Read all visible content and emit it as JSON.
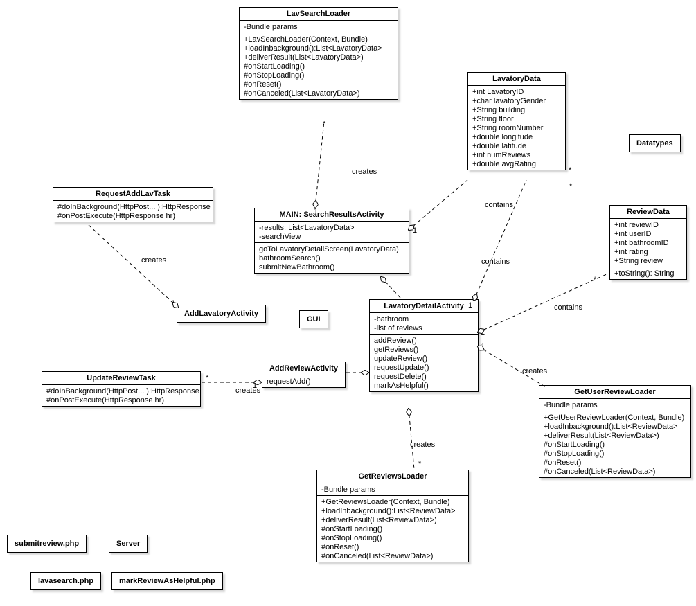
{
  "classes": {
    "lavSearchLoader": {
      "name": "LavSearchLoader",
      "attrs": [
        "-Bundle params"
      ],
      "ops": [
        "+LavSearchLoader(Context, Bundle)",
        "+loadInbackground():List<LavatoryData>",
        "+deliverResult(List<LavatoryData>)",
        "#onStartLoading()",
        "#onStopLoading()",
        "#onReset()",
        "#onCanceled(List<LavatoryData>)"
      ]
    },
    "lavatoryData": {
      "name": "LavatoryData",
      "attrs": [
        "+int LavatoryID",
        "+char lavatoryGender",
        "+String building",
        "+String floor",
        "+String roomNumber",
        "+double longitude",
        "+double latitude",
        "+int numReviews",
        "+double avgRating"
      ]
    },
    "datatypes": {
      "name": "Datatypes"
    },
    "requestAddLavTask": {
      "name": "RequestAddLavTask",
      "ops": [
        "#doInBackground(HttpPost... ):HttpResponse",
        "#onPostExecute(HttpResponse hr)"
      ]
    },
    "searchResultsActivity": {
      "name": "MAIN: SearchResultsActivity",
      "attrs": [
        "-results: List<LavatoryData>",
        "-searchView"
      ],
      "ops": [
        "goToLavatoryDetailScreen(LavatoryData)",
        "bathroomSearch()",
        "submitNewBathroom()"
      ]
    },
    "reviewData": {
      "name": "ReviewData",
      "attrs": [
        "+int reviewID",
        "+int userID",
        "+int bathroomID",
        "+int rating",
        "+String review"
      ],
      "ops": [
        "+toString(): String"
      ]
    },
    "addLavatoryActivity": {
      "name": "AddLavatoryActivity"
    },
    "gui": {
      "name": "GUI"
    },
    "lavatoryDetailActivity": {
      "name": "LavatoryDetailActivity",
      "attrs": [
        "-bathroom",
        "-list of reviews"
      ],
      "ops": [
        "addReview()",
        "getReviews()",
        "updateReview()",
        "requestUpdate()",
        "requestDelete()",
        "markAsHelpful()"
      ]
    },
    "addReviewActivity": {
      "name": "AddReviewActivity",
      "ops": [
        "requestAdd()"
      ]
    },
    "updateReviewTask": {
      "name": "UpdateReviewTask",
      "ops": [
        "#doInBackground(HttpPost... ):HttpResponse",
        "#onPostExecute(HttpResponse hr)"
      ]
    },
    "getUserReviewLoader": {
      "name": "GetUserReviewLoader",
      "attrs": [
        "-Bundle params"
      ],
      "ops": [
        "+GetUserReviewLoader(Context, Bundle)",
        "+loadInbackground():List<ReviewData>",
        "+deliverResult(List<ReviewData>)",
        "#onStartLoading()",
        "#onStopLoading()",
        "#onReset()",
        "#onCanceled(List<ReviewData>)"
      ]
    },
    "getReviewsLoader": {
      "name": "GetReviewsLoader",
      "attrs": [
        "-Bundle params"
      ],
      "ops": [
        "+GetReviewsLoader(Context, Bundle)",
        "+loadInbackground():List<ReviewData>",
        "+deliverResult(List<ReviewData>)",
        "#onStartLoading()",
        "#onStopLoading()",
        "#onReset()",
        "#onCanceled(List<ReviewData>)"
      ]
    },
    "submitreview": {
      "name": "submitreview.php"
    },
    "server": {
      "name": "Server"
    },
    "lavasearch": {
      "name": "lavasearch.php"
    },
    "markReviewAsHelpful": {
      "name": "markReviewAsHelpful.php"
    }
  },
  "labels": {
    "creates1": "creates",
    "creates2": "creates",
    "creates3": "creates",
    "creates4": "creates",
    "creates5": "creates",
    "contains1": "contains",
    "contains2": "contains",
    "contains3": "contains"
  },
  "mult": {
    "one1": "1",
    "star1": "*",
    "one2": "1",
    "one3": "1",
    "one4": "1",
    "star2": "*",
    "one5": "1",
    "star3": "*",
    "one6": "1",
    "one7": "1",
    "star4": "*",
    "star5": "*",
    "star6": "*",
    "one8": "1",
    "star7": "*"
  }
}
